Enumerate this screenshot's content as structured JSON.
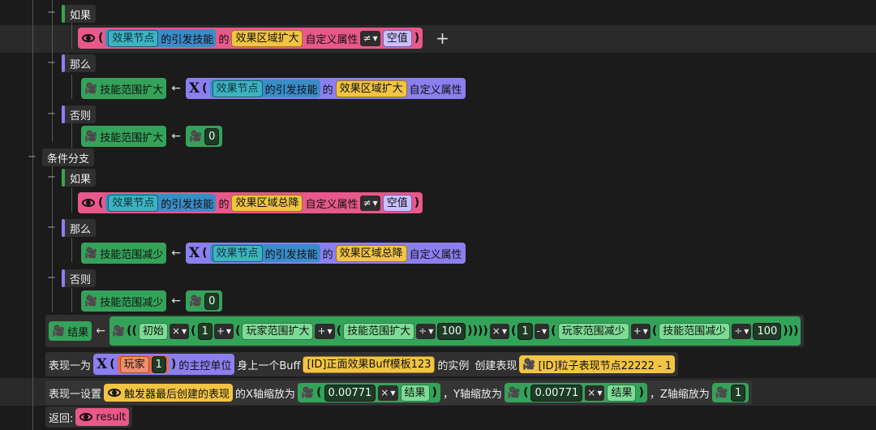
{
  "labels": {
    "if": "如果",
    "then": "那么",
    "else": "否则",
    "branch": "条件分支",
    "arrow": "←",
    "plus": "+"
  },
  "terms": {
    "effect_node": "效果节点",
    "trigger_skill": "的引发技能",
    "of": "的",
    "custom_attr": "自定义属性",
    "neq": "≠",
    "null": "空值",
    "area_expand": "效果区域扩大",
    "area_reduce": "效果区域总降",
    "skill_expand": "技能范围扩大",
    "skill_reduce": "技能范围减少",
    "zero": "0"
  },
  "result_row": {
    "result": "结果",
    "initial": "初始",
    "mul": "×",
    "one": "1",
    "plus_op": "+",
    "minus_op": "-",
    "div": "÷",
    "player_expand": "玩家范围扩大",
    "player_reduce": "玩家范围减少",
    "skill_expand": "技能范围扩大",
    "skill_reduce": "技能范围减少",
    "hundred": "100"
  },
  "present_row": {
    "lead": "表现一为",
    "player": "玩家",
    "player_idx": "1",
    "main_unit": "的主控单位",
    "last_buff": "身上一个Buff",
    "buff_template": "[ID]正面效果Buff模板123",
    "instance": "的实例",
    "create": "创建表现",
    "particle": "[ID]粒子表现节点22222 - 1"
  },
  "set_row": {
    "lead": "表现一设置",
    "trigger_last": "触发器最后创建的表现",
    "x_scale": "的X轴缩放为",
    "val": "0.00771",
    "mul": "×",
    "result": "结果",
    "y_scale": "，Y轴缩放为",
    "z_scale": "，Z轴缩放为",
    "one": "1"
  },
  "return_row": {
    "lead": "返回:",
    "value": "result"
  }
}
